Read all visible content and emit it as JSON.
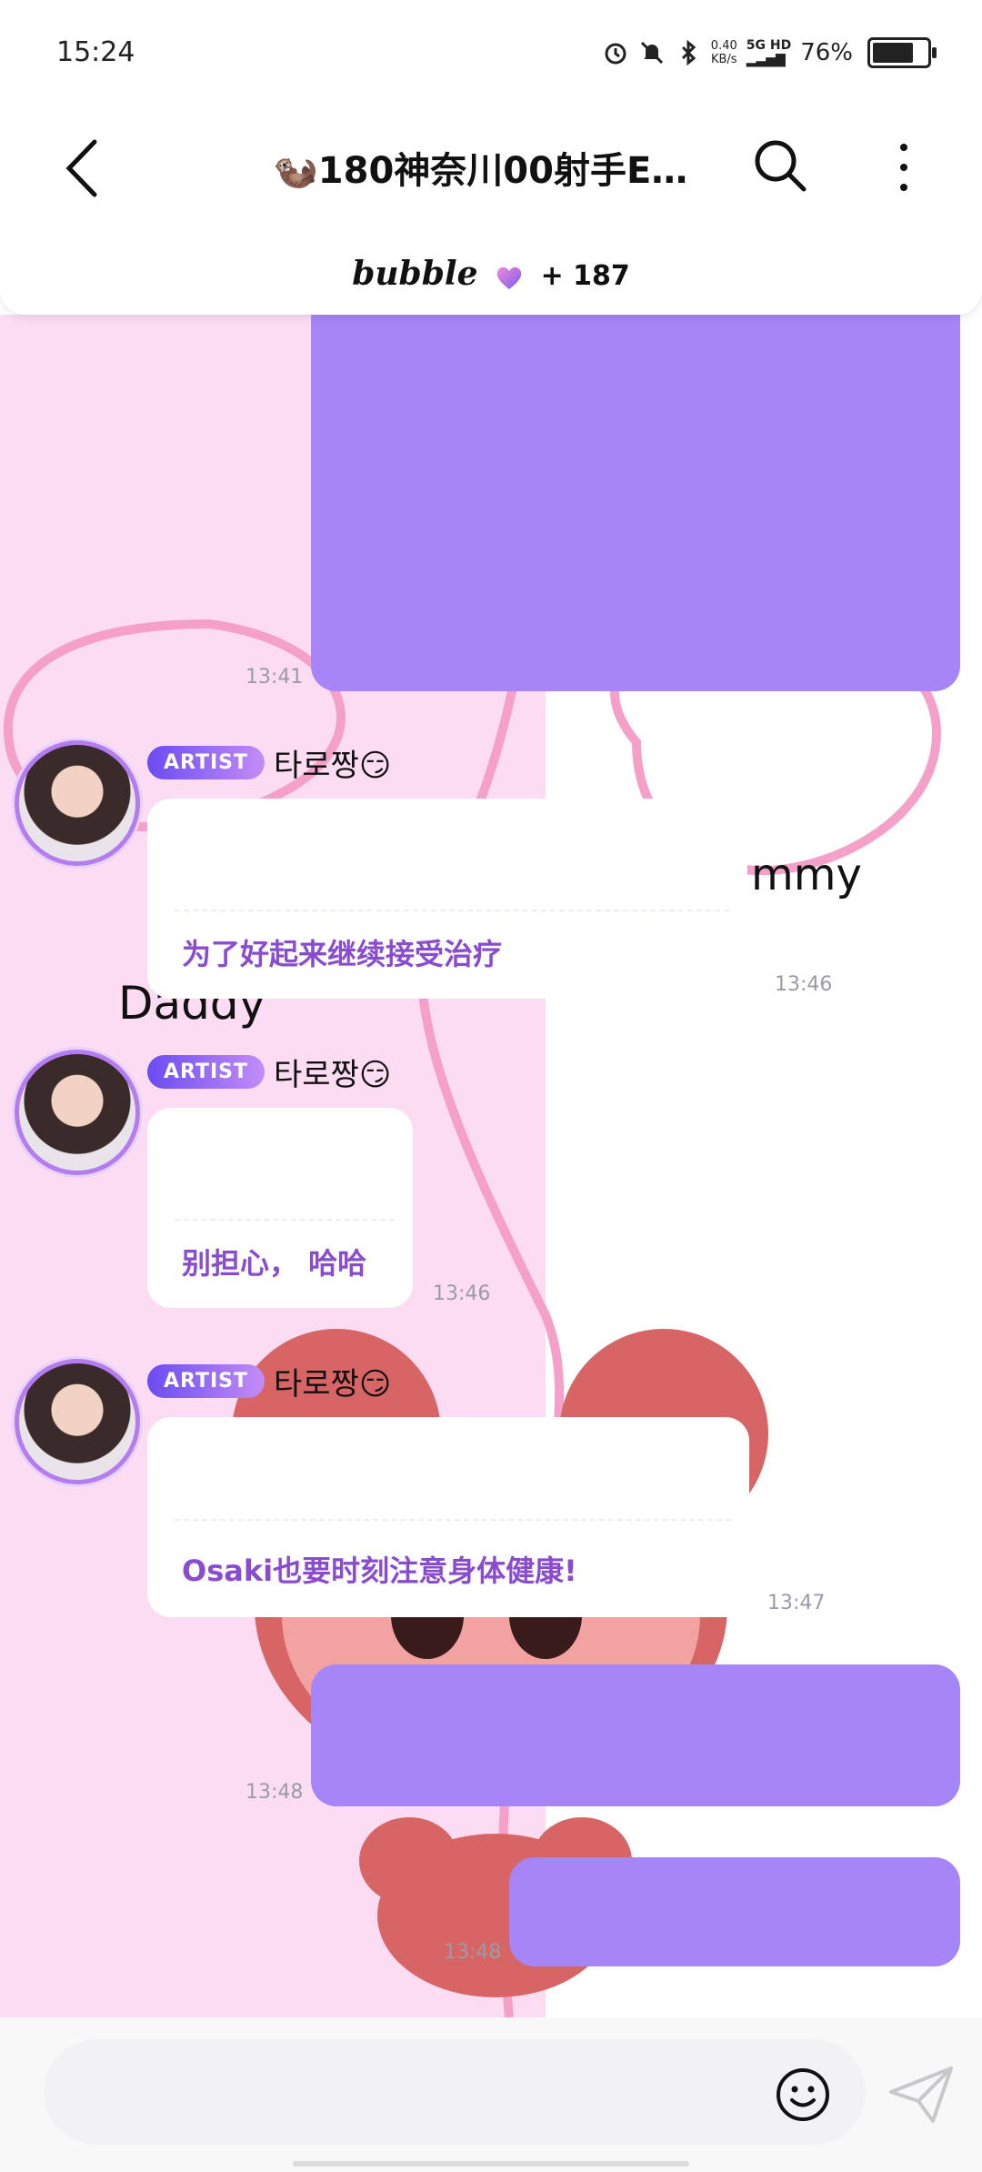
{
  "status_bar": {
    "time": "15:24",
    "net_speed_value": "0.40",
    "net_speed_unit": "KB/s",
    "network_type": "5G HD",
    "battery_percent": "76%",
    "battery_level": 0.76
  },
  "header": {
    "title": "🦦180神奈川00射手E…",
    "brand": "bubble",
    "member_count": "+ 187"
  },
  "messages": [
    {
      "time": "13:41"
    },
    {
      "artist_badge": "ARTIST",
      "artist_name": "타로짱😏",
      "visible_text": "mmy",
      "translation": "为了好起来继续接受治疗",
      "time": "13:46"
    },
    {
      "artist_badge": "ARTIST",
      "artist_name": "타로짱😏",
      "translation": "别担心， 哈哈",
      "time": "13:46"
    },
    {
      "artist_badge": "ARTIST",
      "artist_name": "타로짱😏",
      "translation": "Osaki也要时刻注意身体健康!",
      "time": "13:47"
    },
    {
      "time": "13:48"
    },
    {
      "time": "13:48"
    }
  ],
  "background_text": "Daddy",
  "colors": {
    "outgoing_bubble": "#a686f7",
    "translation_text": "#8a4ccf",
    "pink_bg": "#fcdcf2"
  }
}
